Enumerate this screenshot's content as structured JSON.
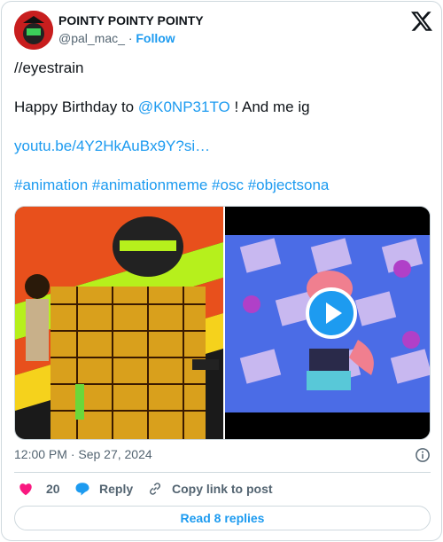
{
  "author": {
    "display_name": "POINTY POINTY POINTY",
    "handle": "@pal_mac_",
    "separator": "·",
    "follow_label": "Follow"
  },
  "tweet": {
    "line1": "//eyestrain",
    "line2_prefix": "Happy Birthday to",
    "line2_mention": "@K0NP31TO",
    "line2_suffix": "! And me ig",
    "url": "youtu.be/4Y2HkAuBx9Y?si…",
    "hashtags": [
      "#animation",
      "#animationmeme",
      "#osc",
      "#objectsona"
    ]
  },
  "timestamp": "12:00 PM · Sep 27, 2024",
  "actions": {
    "like_count": "20",
    "reply_label": "Reply",
    "copy_label": "Copy link to post"
  },
  "read_replies_label": "Read 8 replies",
  "colors": {
    "accent": "#1d9bf0",
    "like": "#f91880",
    "muted": "#536471",
    "border": "#cfd9de"
  },
  "icons": [
    "x-logo-icon",
    "info-icon",
    "heart-icon",
    "reply-bubble-icon",
    "link-icon",
    "play-icon"
  ]
}
